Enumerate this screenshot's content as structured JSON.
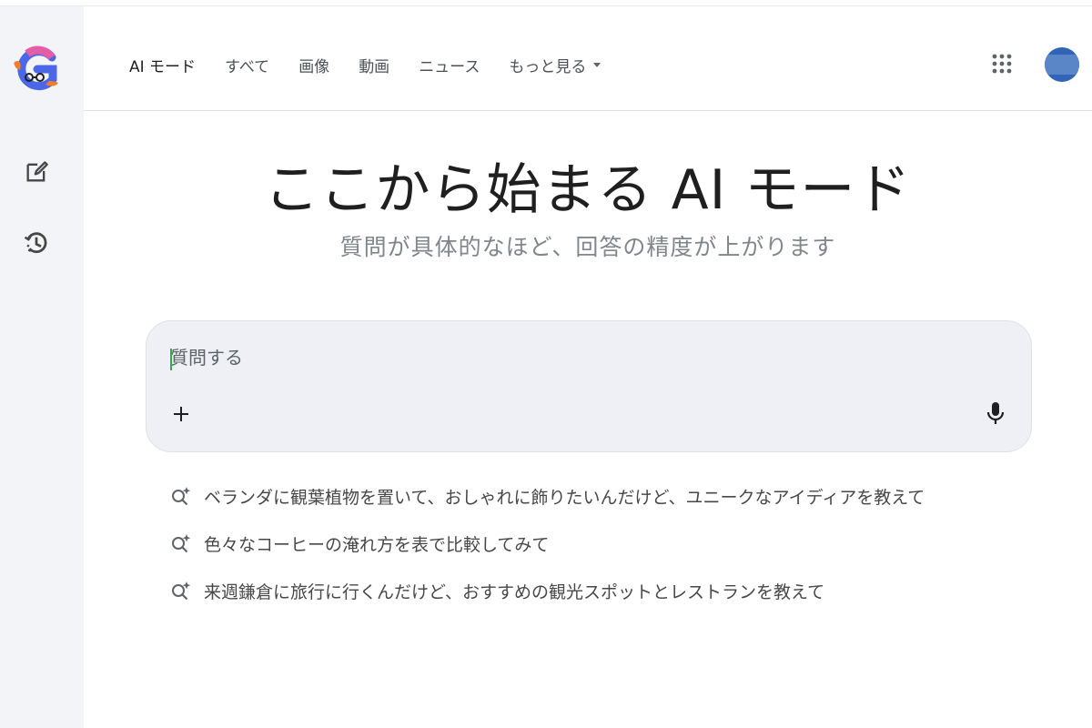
{
  "header": {
    "nav_items": [
      "AI モード",
      "すべて",
      "画像",
      "動画",
      "ニュース"
    ],
    "more_label": "もっと見る"
  },
  "main": {
    "title": "ここから始まる AI モード",
    "subtitle": "質問が具体的なほど、回答の精度が上がります"
  },
  "search": {
    "placeholder": "質問する",
    "value": ""
  },
  "suggestions": [
    "ベランダに観葉植物を置いて、おしゃれに飾りたいんだけど、ユニークなアイディアを教えて",
    "色々なコーヒーの淹れ方を表で比較してみて",
    "来週鎌倉に旅行に行くんだけど、おすすめの観光スポットとレストランを教えて"
  ],
  "icons": {
    "logo": "google-g-logo-icon",
    "new_chat": "edit-icon",
    "history": "history-icon",
    "apps": "apps-grid-icon",
    "add": "plus-icon",
    "mic": "mic-icon",
    "suggestion": "search-sparkle-icon"
  },
  "colors": {
    "sidebar_bg": "#f3f4f7",
    "search_bg": "#eef0f5",
    "subtitle": "#80868b",
    "cursor": "#34a853",
    "avatar": "#2f64b6"
  }
}
